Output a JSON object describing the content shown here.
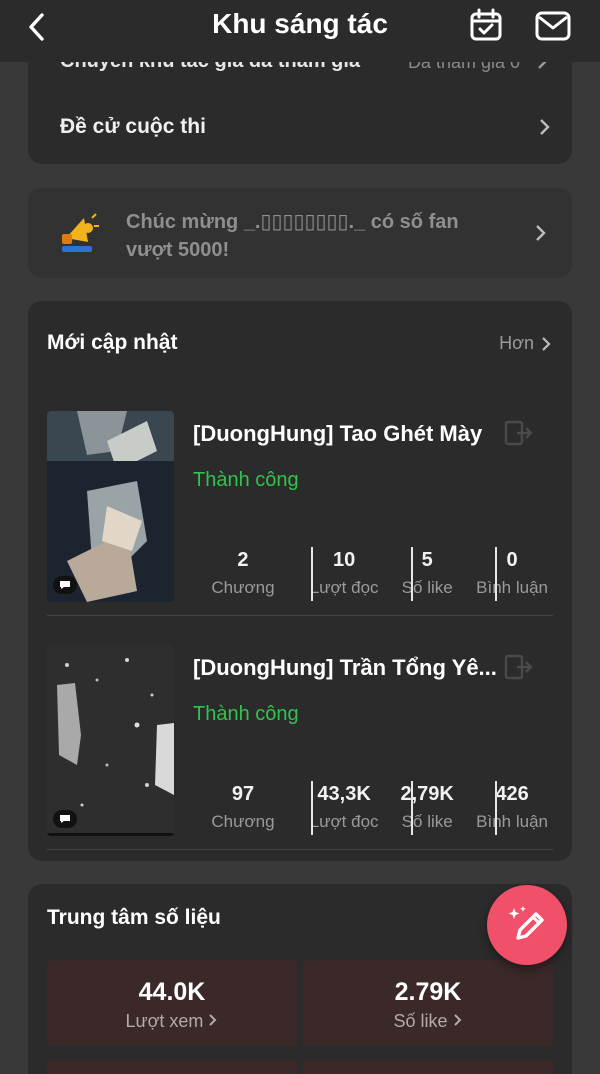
{
  "header": {
    "title": "Khu sáng tác"
  },
  "top_card": {
    "row1_label": "Chuyển khu tác giả đã tham gia",
    "row1_value": "Đã tham gia 0",
    "row2_label": "Đề cử cuộc thi"
  },
  "congrats": {
    "text": "Chúc mừng _.▯▯▯▯▯▯▯▯._ có số fan vượt 5000!"
  },
  "updates": {
    "title": "Mới cập nhật",
    "more_label": "Hơn",
    "works": [
      {
        "title": "[DuongHung] Tao Ghét Mày",
        "status": "Thành công",
        "stats": [
          {
            "value": "2",
            "label": "Chương"
          },
          {
            "value": "10",
            "label": "Lượt đọc"
          },
          {
            "value": "5",
            "label": "Số like"
          },
          {
            "value": "0",
            "label": "Bình luận"
          }
        ]
      },
      {
        "title": "[DuongHung] Trần Tổng Yê...",
        "status": "Thành công",
        "stats": [
          {
            "value": "97",
            "label": "Chương"
          },
          {
            "value": "43,3K",
            "label": "Lượt đọc"
          },
          {
            "value": "2,79K",
            "label": "Số like"
          },
          {
            "value": "426",
            "label": "Bình luận"
          }
        ]
      }
    ]
  },
  "data_center": {
    "title": "Trung tâm số liệu",
    "metrics": [
      {
        "value": "44.0K",
        "label": "Lượt xem"
      },
      {
        "value": "2.79K",
        "label": "Số like"
      }
    ]
  },
  "colors": {
    "background": "#393939",
    "card": "#2b2b2b",
    "status_green": "#33c24d",
    "fab": "#f0506a",
    "metric_bg": "#3b2929"
  }
}
